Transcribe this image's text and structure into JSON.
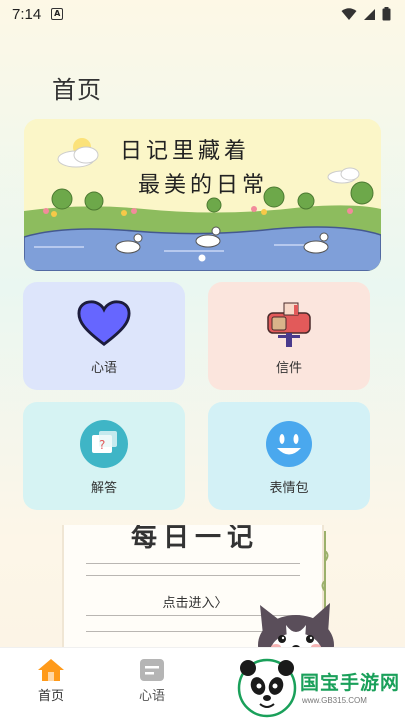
{
  "status_bar": {
    "time": "7:14",
    "a_badge": "A"
  },
  "header": {
    "title": "首页"
  },
  "banner": {
    "line1": "日记里藏着",
    "line2": "最美的日常"
  },
  "cards": [
    {
      "label": "心语",
      "icon": "heart-icon",
      "color": "#6666ff"
    },
    {
      "label": "信件",
      "icon": "mailbox-icon",
      "color": "#e25a5a"
    },
    {
      "label": "解答",
      "icon": "question-chat-icon",
      "color": "#3fb5c6"
    },
    {
      "label": "表情包",
      "icon": "smiley-icon",
      "color": "#4aa8ee"
    }
  ],
  "daily": {
    "title": "每日一记",
    "enter": "点击进入〉"
  },
  "tabs": [
    {
      "label": "首页",
      "icon": "home-icon",
      "active": true
    },
    {
      "label": "心语",
      "icon": "note-icon",
      "active": false
    }
  ],
  "watermark": {
    "brand": "国宝手游网",
    "url": "www.GB315.COM"
  },
  "colors": {
    "accent": "#ff9a1a"
  }
}
